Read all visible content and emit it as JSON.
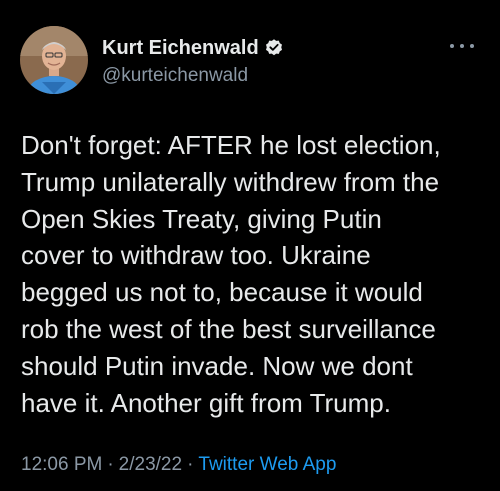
{
  "author": {
    "display_name": "Kurt Eichenwald",
    "handle": "@kurteichenwald",
    "verified": true,
    "avatar_icon": "profile-photo"
  },
  "tweet": {
    "lines": [
      "Don't forget: AFTER he lost election,",
      "Trump unilaterally withdrew from the",
      "Open Skies Treaty, giving Putin",
      "cover to withdraw too. Ukraine",
      "begged us not to, because it would",
      "rob the west of the best surveillance",
      "should Putin invade. Now we dont",
      "have it. Another gift from Trump."
    ]
  },
  "meta": {
    "time": "12:06 PM",
    "separator": "·",
    "date": "2/23/22",
    "source": "Twitter Web App"
  },
  "colors": {
    "background": "#000000",
    "text": "#e7e9ea",
    "secondary": "#8b98a5",
    "accent": "#1d9bf0"
  },
  "icons": {
    "more": "more-options-icon",
    "verified": "verified-badge-icon"
  }
}
